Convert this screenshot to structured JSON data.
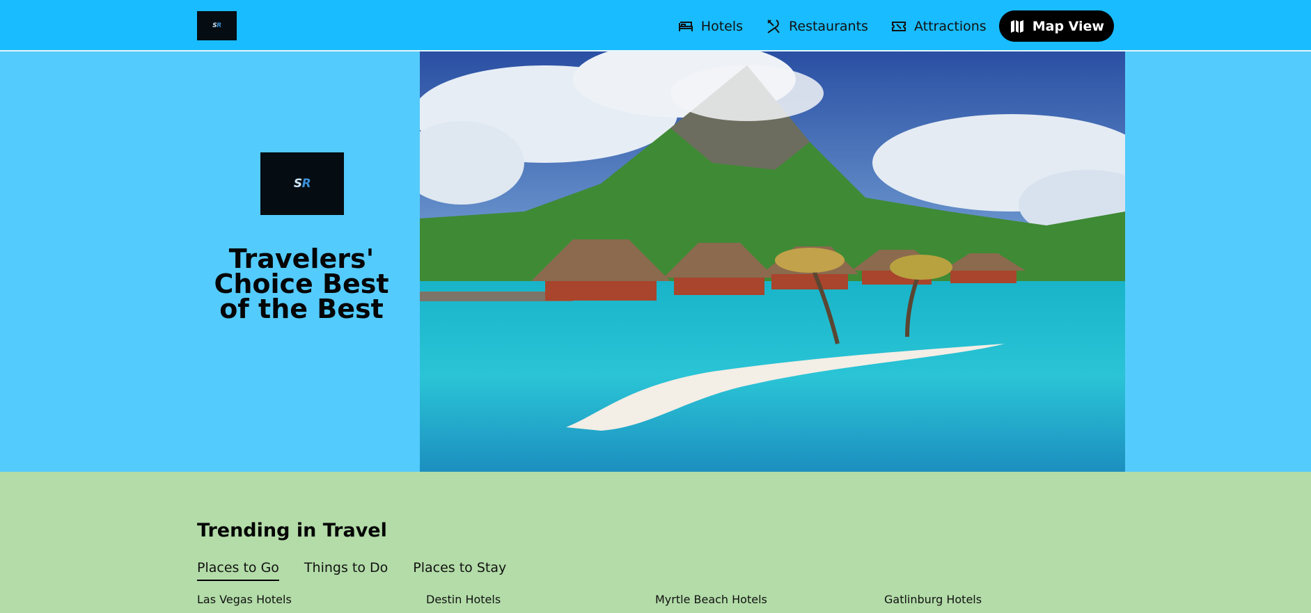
{
  "header": {
    "logo_text_main": "S",
    "logo_text_accent": "R",
    "nav": [
      {
        "label": "Hotels",
        "icon": "bed-icon"
      },
      {
        "label": "Restaurants",
        "icon": "fork-knife-icon"
      },
      {
        "label": "Attractions",
        "icon": "ticket-icon"
      }
    ],
    "map_view_label": "Map View"
  },
  "hero": {
    "title": "Travelers' Choice Best of the Best",
    "bg_color": "#54cbfd"
  },
  "trending": {
    "title": "Trending in Travel",
    "tabs": [
      "Places to Go",
      "Things to Do",
      "Places to Stay"
    ],
    "active_tab": "Places to Go",
    "links": [
      "Las Vegas Hotels",
      "Destin Hotels",
      "Myrtle Beach Hotels",
      "Gatlinburg Hotels"
    ]
  },
  "colors": {
    "header_bg": "#19bcfe",
    "hero_bg": "#54cbfd",
    "section_bg": "#b3dca8"
  }
}
